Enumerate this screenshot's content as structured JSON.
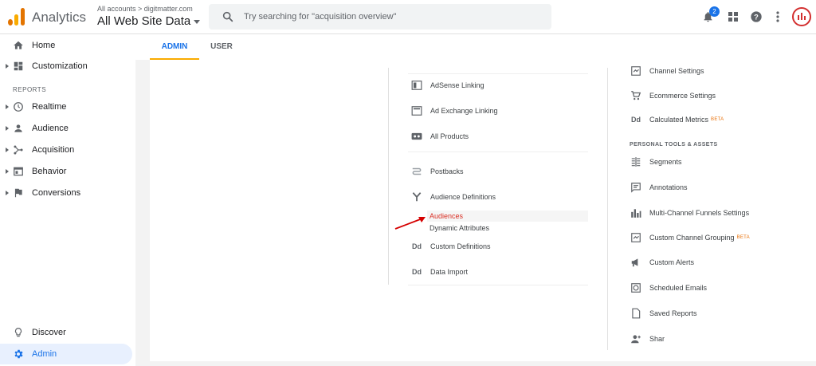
{
  "header": {
    "app_name": "Analytics",
    "account_crumb": "All accounts > digitmatter.com",
    "view_title": "All Web Site Data",
    "search_placeholder": "Try searching for \"acquisition overview\"",
    "notification_count": "2"
  },
  "sidebar": {
    "items_top": [
      {
        "label": "Home",
        "icon": "home-icon"
      },
      {
        "label": "Customization",
        "icon": "dashboard-icon"
      }
    ],
    "section_label": "REPORTS",
    "reports": [
      {
        "label": "Realtime",
        "icon": "clock-icon"
      },
      {
        "label": "Audience",
        "icon": "person-icon"
      },
      {
        "label": "Acquisition",
        "icon": "acquisition-icon"
      },
      {
        "label": "Behavior",
        "icon": "behavior-icon"
      },
      {
        "label": "Conversions",
        "icon": "flag-icon"
      }
    ],
    "bottom": [
      {
        "label": "Discover",
        "icon": "lightbulb-icon"
      },
      {
        "label": "Admin",
        "icon": "gear-icon"
      }
    ]
  },
  "tabs": [
    {
      "label": "ADMIN"
    },
    {
      "label": "USER"
    }
  ],
  "property_column": {
    "items": [
      {
        "label": "AdSense Linking"
      },
      {
        "label": "Ad Exchange Linking"
      },
      {
        "label": "All Products"
      },
      {
        "label": "Postbacks"
      },
      {
        "label": "Audience Definitions"
      },
      {
        "label": "Custom Definitions"
      },
      {
        "label": "Data Import"
      }
    ],
    "sub_items": [
      {
        "label": "Audiences"
      },
      {
        "label": "Dynamic Attributes"
      }
    ]
  },
  "view_column": {
    "items_top": [
      {
        "label": "Channel Settings"
      },
      {
        "label": "Ecommerce Settings"
      },
      {
        "label": "Calculated Metrics",
        "badge": "BETA"
      }
    ],
    "section_label": "PERSONAL TOOLS & ASSETS",
    "items_tools": [
      {
        "label": "Segments"
      },
      {
        "label": "Annotations"
      },
      {
        "label": "Multi-Channel Funnels Settings"
      },
      {
        "label": "Custom Channel Grouping",
        "badge": "BETA"
      },
      {
        "label": "Custom Alerts"
      },
      {
        "label": "Scheduled Emails"
      },
      {
        "label": "Saved Reports"
      },
      {
        "label": "Shar"
      }
    ]
  },
  "dd_glyph": "Dd",
  "colors": {
    "accent": "#1a73e8",
    "tab_underline": "#f9ab00",
    "selected_subitem": "#d93025",
    "beta": "#e8710a",
    "arrow": "#d50000"
  }
}
